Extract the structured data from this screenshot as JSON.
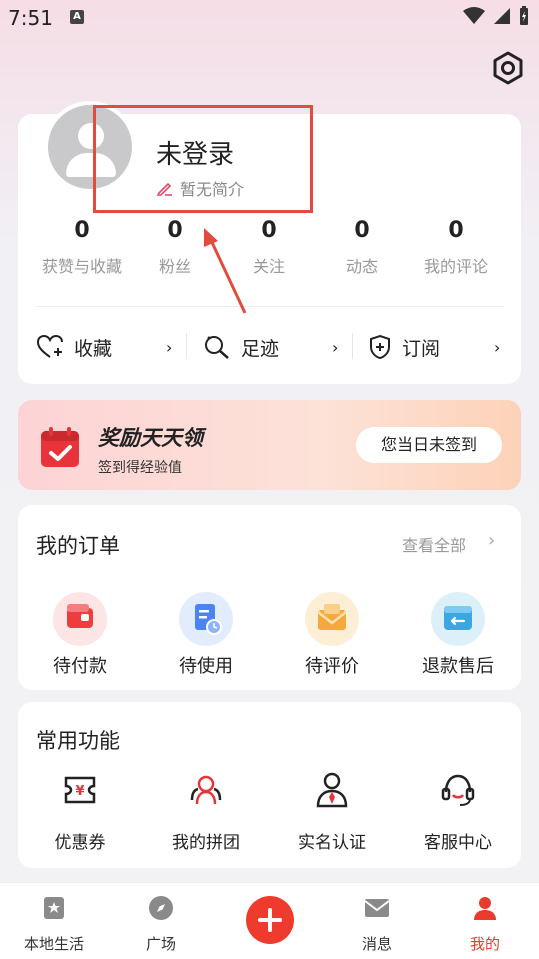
{
  "status_bar": {
    "time": "7:51"
  },
  "profile": {
    "username": "未登录",
    "bio": "暂无简介",
    "stats": [
      {
        "value": "0",
        "label": "获赞与收藏"
      },
      {
        "value": "0",
        "label": "粉丝"
      },
      {
        "value": "0",
        "label": "关注"
      },
      {
        "value": "0",
        "label": "动态"
      },
      {
        "value": "0",
        "label": "我的评论"
      }
    ],
    "quick_links": [
      {
        "label": "收藏"
      },
      {
        "label": "足迹"
      },
      {
        "label": "订阅"
      }
    ]
  },
  "reward": {
    "title": "奖励天天领",
    "subtitle": "签到得经验值",
    "button": "您当日未签到"
  },
  "orders": {
    "title": "我的订单",
    "view_all": "查看全部",
    "items": [
      {
        "label": "待付款",
        "icon": "wallet-icon"
      },
      {
        "label": "待使用",
        "icon": "document-clock-icon"
      },
      {
        "label": "待评价",
        "icon": "envelope-icon"
      },
      {
        "label": "退款售后",
        "icon": "refund-box-icon"
      }
    ]
  },
  "functions": {
    "title": "常用功能",
    "items": [
      {
        "label": "优惠券",
        "icon": "coupon-icon"
      },
      {
        "label": "我的拼团",
        "icon": "group-icon"
      },
      {
        "label": "实名认证",
        "icon": "identity-icon"
      },
      {
        "label": "客服中心",
        "icon": "headset-icon"
      }
    ]
  },
  "tabbar": {
    "items": [
      {
        "label": "本地生活",
        "icon": "local-life-icon"
      },
      {
        "label": "广场",
        "icon": "compass-icon"
      },
      {
        "label": "",
        "icon": "plus-icon"
      },
      {
        "label": "消息",
        "icon": "mail-icon"
      },
      {
        "label": "我的",
        "icon": "person-icon"
      }
    ],
    "active_color": "#e83c2e"
  }
}
